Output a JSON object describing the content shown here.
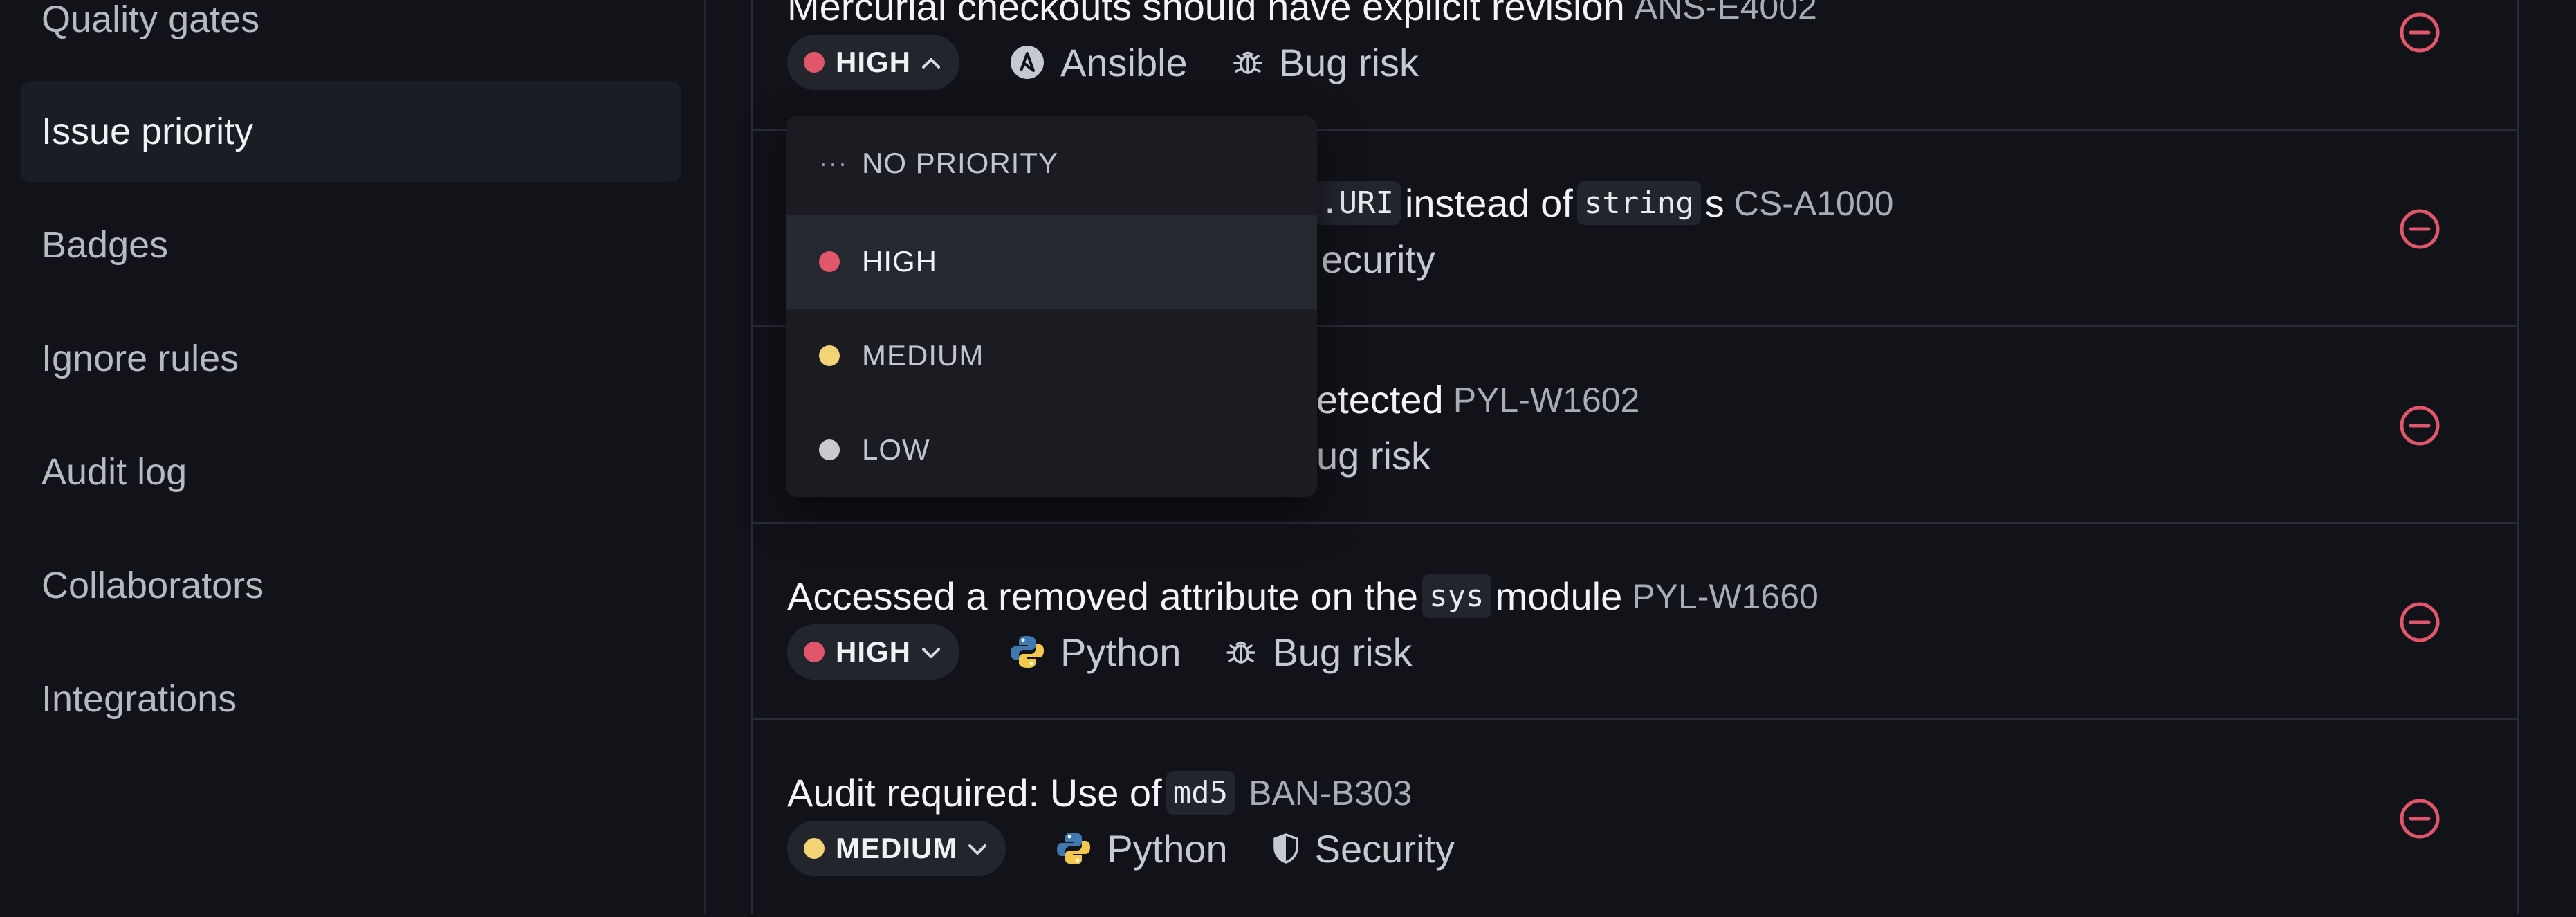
{
  "sidebar": {
    "items": [
      {
        "label": "Quality gates",
        "active": false
      },
      {
        "label": "Issue priority",
        "active": true
      },
      {
        "label": "Badges",
        "active": false
      },
      {
        "label": "Ignore rules",
        "active": false
      },
      {
        "label": "Audit log",
        "active": false
      },
      {
        "label": "Collaborators",
        "active": false
      },
      {
        "label": "Integrations",
        "active": false
      }
    ]
  },
  "issues": [
    {
      "title_parts": [
        {
          "text": "Mercurial checkouts should have explicit revision",
          "code": false
        }
      ],
      "rule_id": "ANS-E4002",
      "priority": "HIGH",
      "priority_color": "#e0566a",
      "dropdown_open": true,
      "language": "Ansible",
      "language_icon": "ansible-icon",
      "category": "Bug risk",
      "category_icon": "bug-icon"
    },
    {
      "title_parts": [
        {
          "text": ".URI",
          "code": true
        },
        {
          "text": " instead of ",
          "code": false
        },
        {
          "text": "string",
          "code": true
        },
        {
          "text": "s",
          "code": false
        }
      ],
      "rule_id": "CS-A1000",
      "category": "ecurity",
      "category_icon": "shield-icon"
    },
    {
      "title_parts": [
        {
          "text": "etected",
          "code": false
        }
      ],
      "rule_id": "PYL-W1602",
      "category": "ug risk",
      "category_icon": "bug-icon"
    },
    {
      "title_parts": [
        {
          "text": "Accessed a removed attribute on the ",
          "code": false
        },
        {
          "text": "sys",
          "code": true
        },
        {
          "text": " module",
          "code": false
        }
      ],
      "rule_id": "PYL-W1660",
      "priority": "HIGH",
      "priority_color": "#e0566a",
      "language": "Python",
      "language_icon": "python-icon",
      "category": "Bug risk",
      "category_icon": "bug-icon"
    },
    {
      "title_parts": [
        {
          "text": "Audit required: Use of ",
          "code": false
        },
        {
          "text": "md5",
          "code": true
        }
      ],
      "rule_id": "BAN-B303",
      "priority": "MEDIUM",
      "priority_color": "#f3d475",
      "language": "Python",
      "language_icon": "python-icon",
      "category": "Security",
      "category_icon": "shield-icon"
    }
  ],
  "priority_dropdown": {
    "options": [
      {
        "label": "NO PRIORITY",
        "icon": "ellipsis-icon"
      },
      {
        "label": "HIGH",
        "color": "#e0566a",
        "selected": true
      },
      {
        "label": "MEDIUM",
        "color": "#f3d475"
      },
      {
        "label": "LOW",
        "color": "#c9c9cf"
      }
    ]
  },
  "colors": {
    "background": "#121319",
    "remove_icon": "#e0566a",
    "high": "#e0566a",
    "medium": "#f3d475",
    "low": "#c9c9cf"
  }
}
